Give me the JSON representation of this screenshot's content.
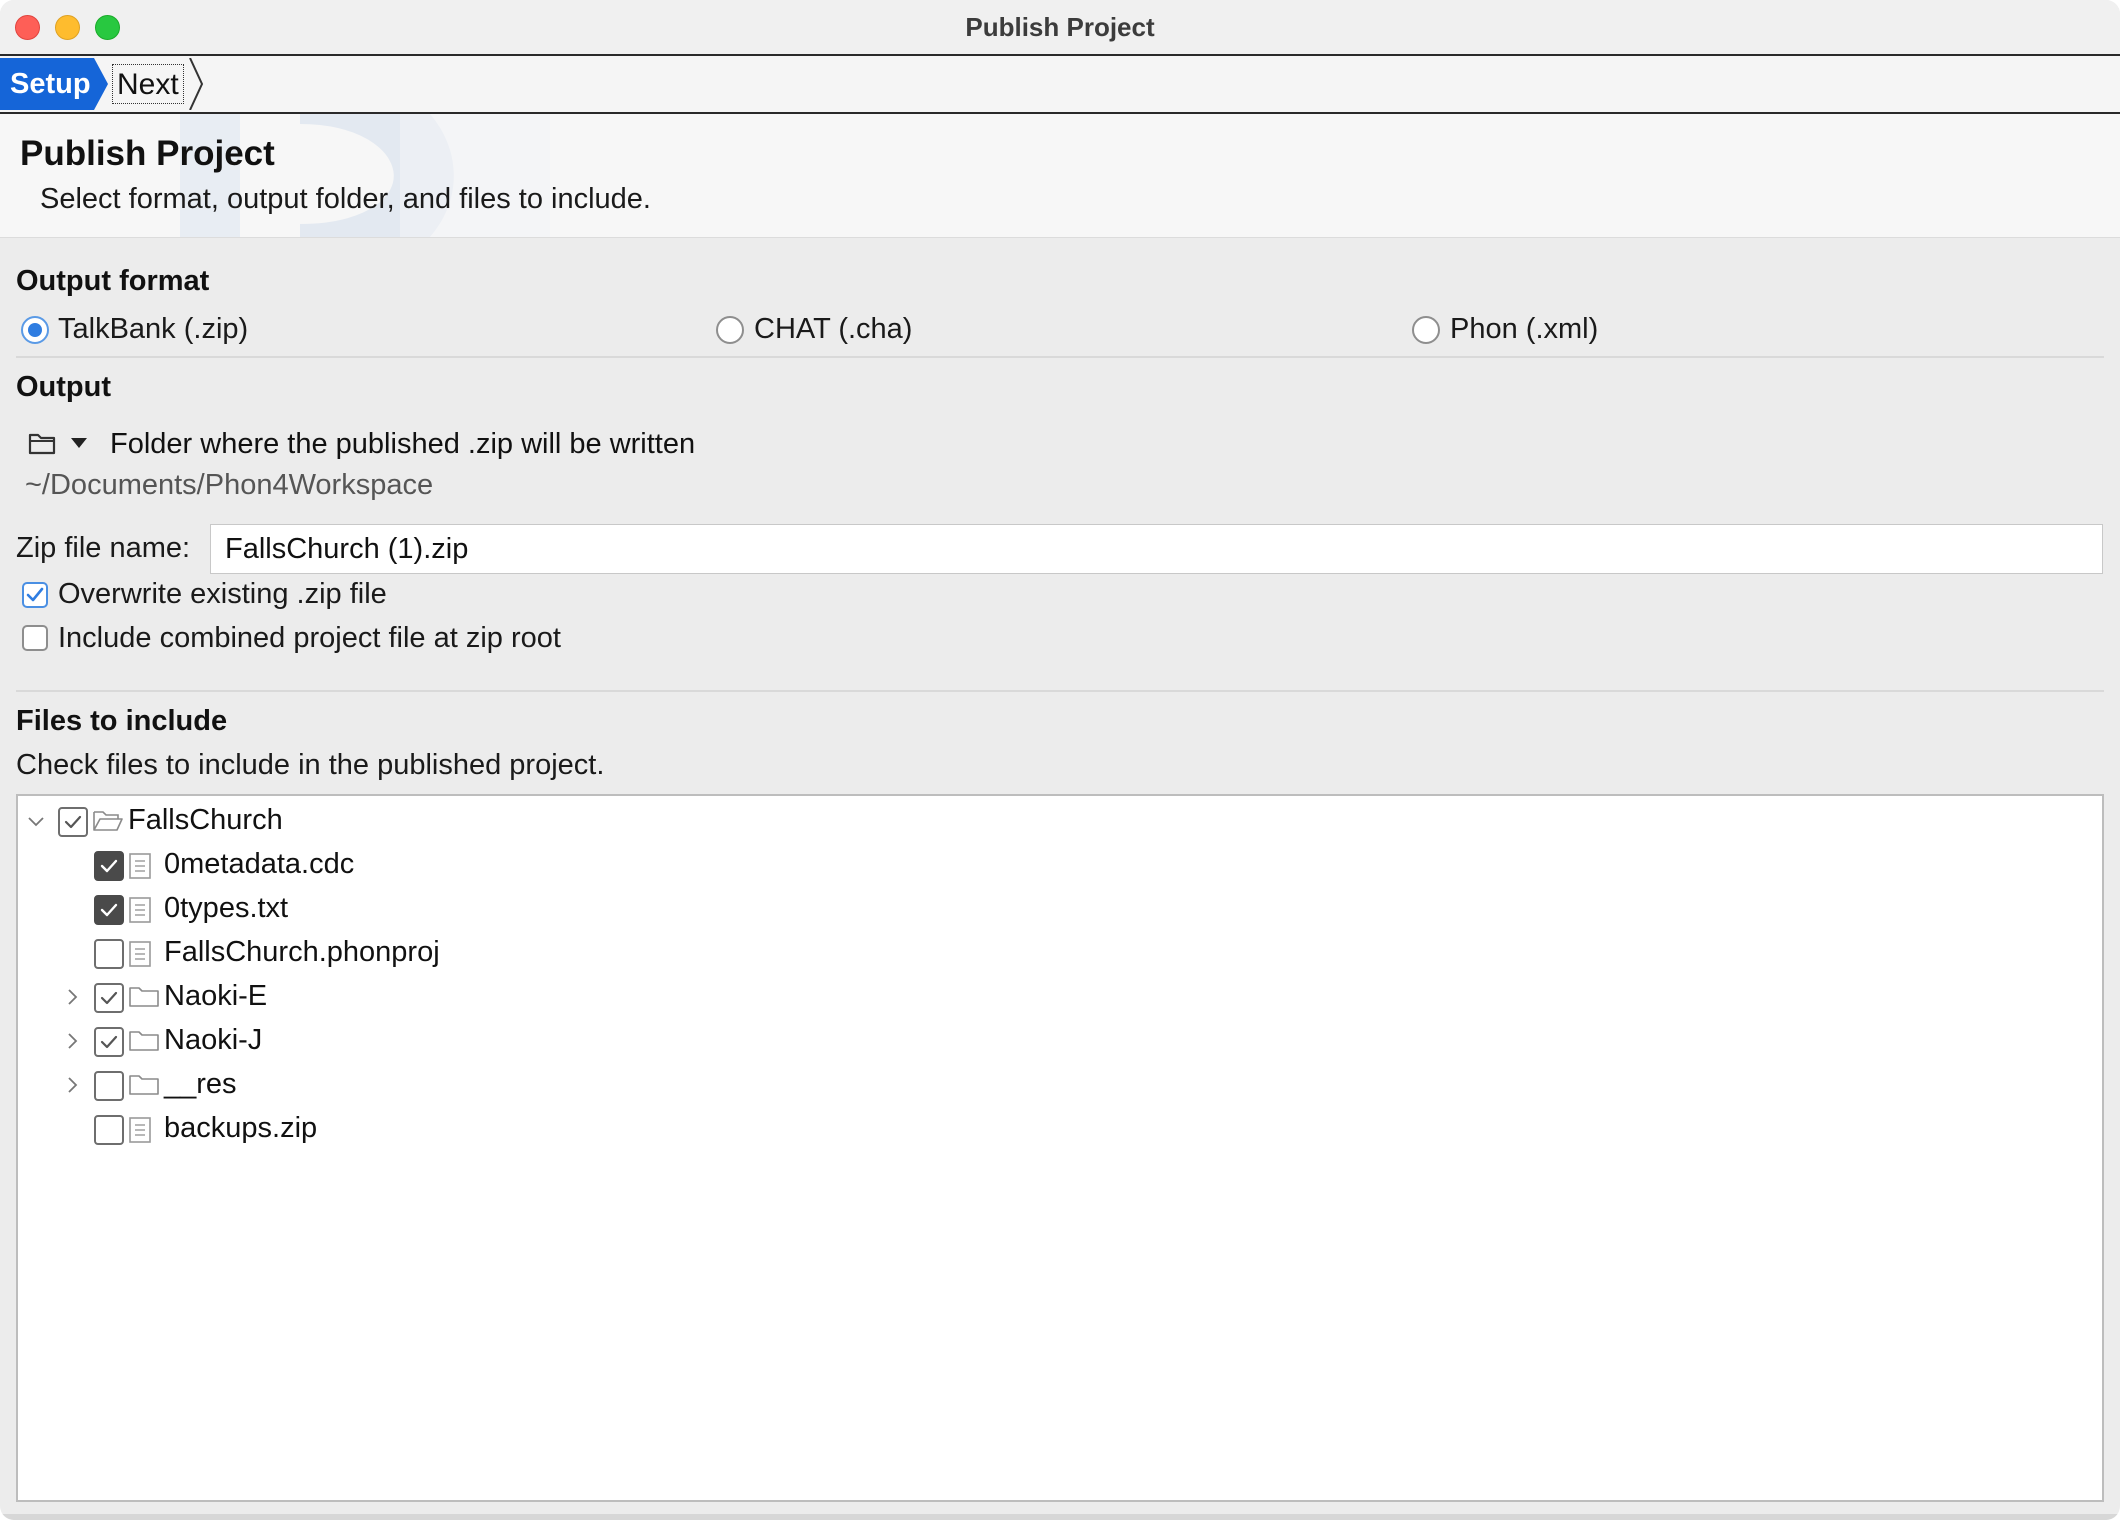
{
  "window": {
    "title": "Publish Project"
  },
  "breadcrumb": {
    "setup": "Setup",
    "next": "Next"
  },
  "header": {
    "title": "Publish Project",
    "subtitle": "Select format, output folder, and files to include."
  },
  "output_format": {
    "title": "Output format",
    "options": [
      {
        "label": "TalkBank (.zip)",
        "selected": true
      },
      {
        "label": "CHAT (.cha)",
        "selected": false
      },
      {
        "label": "Phon (.xml)",
        "selected": false
      }
    ]
  },
  "output": {
    "title": "Output",
    "folder_label": "Folder where the published .zip will be written",
    "folder_path": "~/Documents/Phon4Workspace",
    "zip_label": "Zip file name:",
    "zip_value": "FallsChurch (1).zip",
    "overwrite_label": "Overwrite existing .zip file",
    "overwrite_checked": true,
    "include_combined_label": "Include combined project file at zip root",
    "include_combined_checked": false
  },
  "files": {
    "title": "Files to include",
    "instructions": "Check files to include in the published project.",
    "tree": [
      {
        "label": "FallsChurch",
        "type": "folder",
        "expanded": true,
        "checked": true,
        "level": 0
      },
      {
        "label": "0metadata.cdc",
        "type": "file",
        "checked": true,
        "level": 1
      },
      {
        "label": "0types.txt",
        "type": "file",
        "checked": true,
        "level": 1
      },
      {
        "label": "FallsChurch.phonproj",
        "type": "file",
        "checked": false,
        "level": 1
      },
      {
        "label": "Naoki-E",
        "type": "folder",
        "expanded": false,
        "checked": true,
        "level": 1
      },
      {
        "label": "Naoki-J",
        "type": "folder",
        "expanded": false,
        "checked": true,
        "level": 1
      },
      {
        "label": "__res",
        "type": "folder",
        "expanded": false,
        "checked": false,
        "level": 1
      },
      {
        "label": "backups.zip",
        "type": "file",
        "checked": false,
        "level": 1
      }
    ]
  },
  "colors": {
    "accent": "#1565d8",
    "radio_selected": "#2f7de1",
    "window_bg": "#ececec"
  }
}
